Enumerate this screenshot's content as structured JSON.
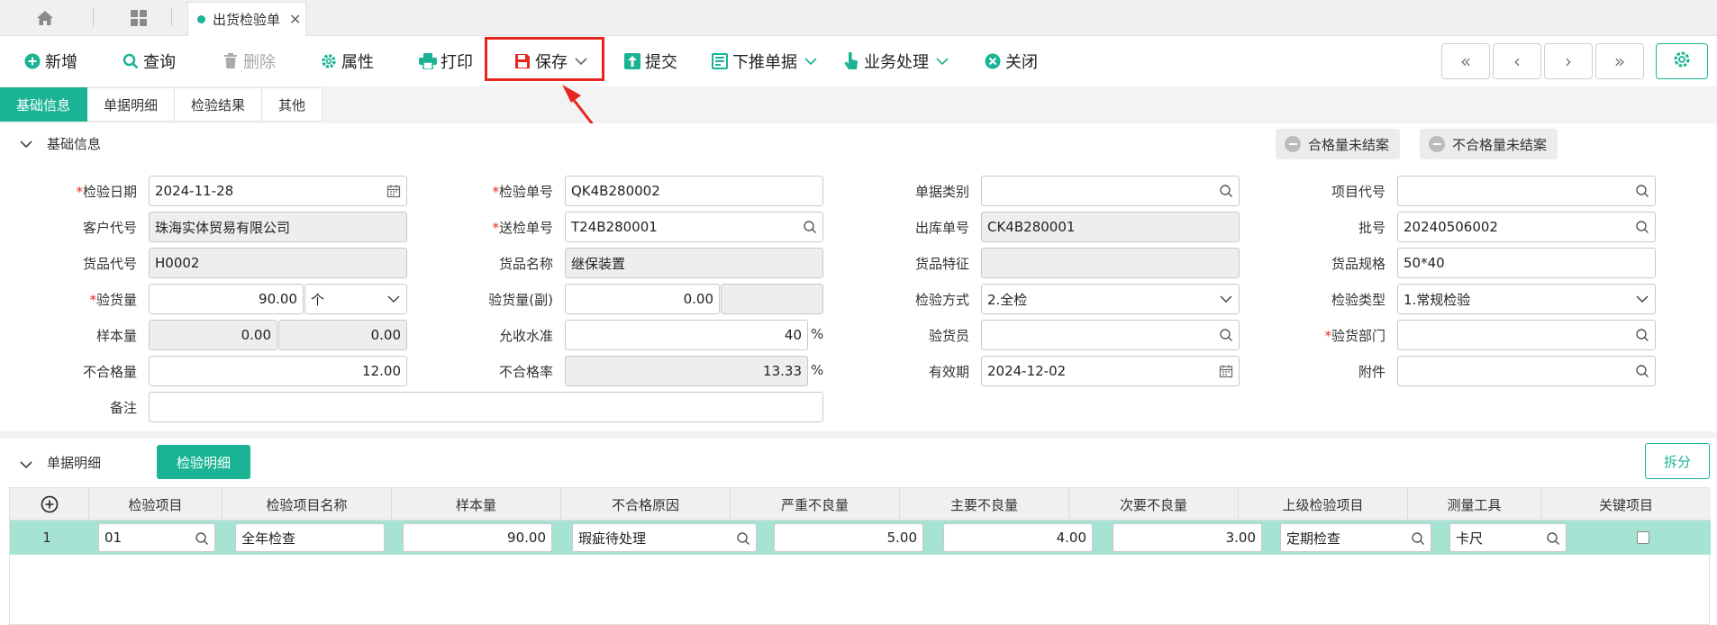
{
  "tab": {
    "title": "出货检验单"
  },
  "toolbar": {
    "add": "新增",
    "query": "查询",
    "delete": "删除",
    "props": "属性",
    "print": "打印",
    "save": "保存",
    "submit": "提交",
    "push": "下推单据",
    "business": "业务处理",
    "close": "关闭"
  },
  "nav": {
    "first": "«",
    "prev": "‹",
    "next": "›",
    "last": "»"
  },
  "subtabs": [
    "基础信息",
    "单据明细",
    "检验结果",
    "其他"
  ],
  "basic": {
    "title": "基础信息",
    "pill_pass": "合格量未结案",
    "pill_fail": "不合格量未结案",
    "fields": {
      "inspect_date": {
        "label": "检验日期",
        "value": "2024-11-28"
      },
      "inspect_no": {
        "label": "检验单号",
        "value": "QK4B280002"
      },
      "doc_type": {
        "label": "单据类别",
        "value": ""
      },
      "project_code": {
        "label": "项目代号",
        "value": ""
      },
      "customer_code": {
        "label": "客户代号",
        "value": "珠海实体贸易有限公司"
      },
      "send_no": {
        "label": "送检单号",
        "value": "T24B280001"
      },
      "outbound_no": {
        "label": "出库单号",
        "value": "CK4B280001"
      },
      "batch_no": {
        "label": "批号",
        "value": "20240506002"
      },
      "goods_code": {
        "label": "货品代号",
        "value": "H0002"
      },
      "goods_name": {
        "label": "货品名称",
        "value": "继保装置"
      },
      "goods_feature": {
        "label": "货品特征",
        "value": ""
      },
      "goods_spec": {
        "label": "货品规格",
        "value": "50*40"
      },
      "check_qty": {
        "label": "验货量",
        "value": "90.00",
        "unit": "个"
      },
      "check_qty_sub": {
        "label": "验货量(副)",
        "value": "0.00",
        "unit": ""
      },
      "inspect_method": {
        "label": "检验方式",
        "value": "2.全检"
      },
      "inspect_type": {
        "label": "检验类型",
        "value": "1.常规检验"
      },
      "sample_qty": {
        "label": "样本量",
        "value": "0.00",
        "value2": "0.00"
      },
      "accept_level": {
        "label": "允收水准",
        "value": "40",
        "unit": "%"
      },
      "inspector": {
        "label": "验货员",
        "value": ""
      },
      "inspect_dept": {
        "label": "验货部门",
        "value": ""
      },
      "fail_qty": {
        "label": "不合格量",
        "value": "12.00"
      },
      "fail_rate": {
        "label": "不合格率",
        "value": "13.33",
        "unit": "%"
      },
      "valid_date": {
        "label": "有效期",
        "value": "2024-12-02"
      },
      "attachment": {
        "label": "附件",
        "value": ""
      },
      "remark": {
        "label": "备注",
        "value": ""
      }
    }
  },
  "detail": {
    "title": "单据明细",
    "tab_btn": "检验明细",
    "split": "拆分",
    "columns": [
      "检验项目",
      "检验项目名称",
      "样本量",
      "不合格原因",
      "严重不良量",
      "主要不良量",
      "次要不良量",
      "上级检验项目",
      "测量工具",
      "关键项目"
    ],
    "rows": [
      {
        "no": "1",
        "item": "01",
        "item_name": "全年检查",
        "sample": "90.00",
        "reason": "瑕疵待处理",
        "critical": "5.00",
        "major": "4.00",
        "minor": "3.00",
        "parent": "定期检查",
        "tool": "卡尺",
        "key": false
      }
    ]
  }
}
